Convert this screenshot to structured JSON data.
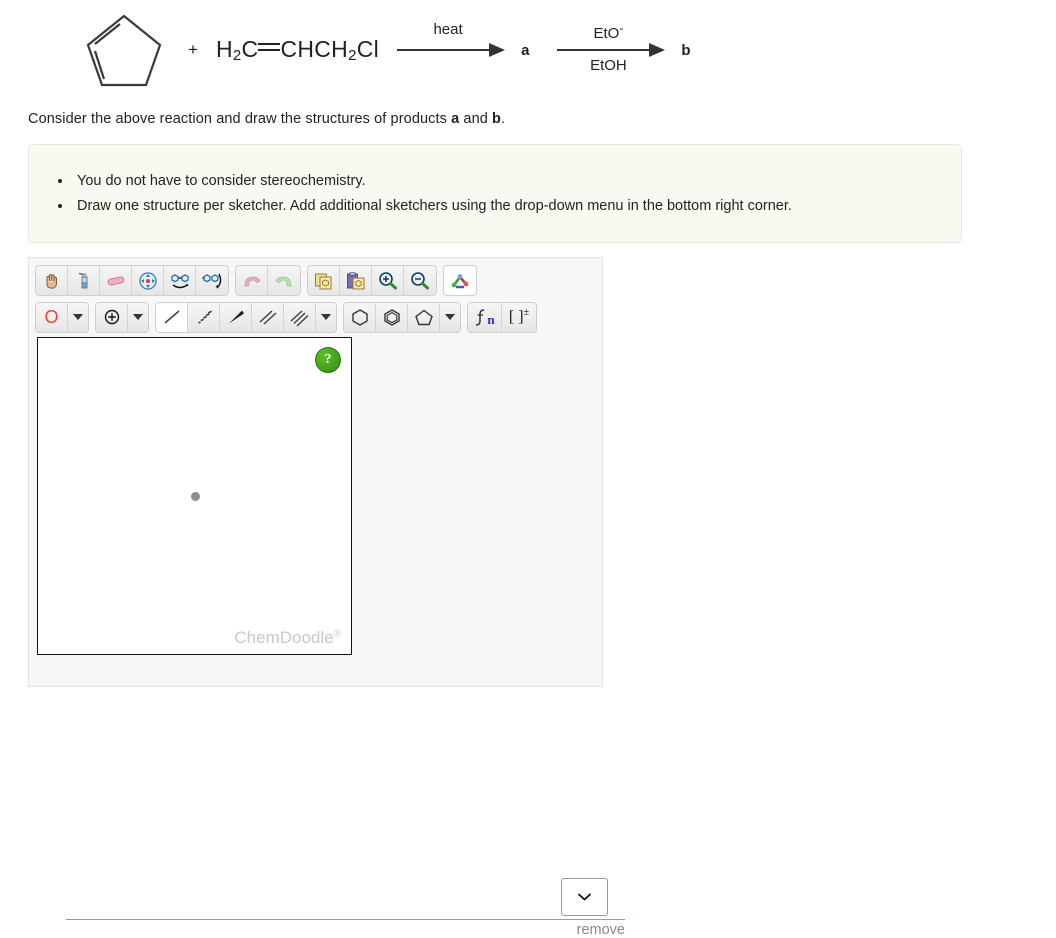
{
  "reaction": {
    "reactant_structure": "cyclopentadiene-ring",
    "plus": "+",
    "reactant_formula_parts": {
      "h": "H",
      "h_sub": "2",
      "c1": "C",
      "ch": "CHCH",
      "ch_sub": "2",
      "cl": "Cl"
    },
    "arrow1": {
      "above": "heat",
      "below": ""
    },
    "product_a": "a",
    "arrow2": {
      "above": "EtO",
      "above_sup": "-",
      "below": "EtOH"
    },
    "product_b": "b"
  },
  "prompt": {
    "text_before": "Consider the above reaction and draw the structures of products ",
    "bold_a": "a",
    "text_middle": " and ",
    "bold_b": "b",
    "text_after": "."
  },
  "notes": {
    "items": [
      "You do not have to consider stereochemistry.",
      "Draw one structure per sketcher. Add additional sketchers using the drop-down menu in the bottom right corner."
    ]
  },
  "sketcher": {
    "toolbar_row1": [
      {
        "name": "pan-hand-icon",
        "title": "Pan",
        "selected": false
      },
      {
        "name": "clear-bottle-icon",
        "title": "Clear",
        "selected": false
      },
      {
        "name": "eraser-icon",
        "title": "Erase",
        "selected": false
      },
      {
        "name": "center-target-icon",
        "title": "Center",
        "selected": false
      },
      {
        "name": "flip-horizontal-icon",
        "title": "Flip Horizontal",
        "selected": false
      },
      {
        "name": "flip-vertical-icon",
        "title": "Flip Vertical",
        "selected": false
      },
      {
        "name": "undo-icon",
        "title": "Undo",
        "selected": false
      },
      {
        "name": "redo-icon",
        "title": "Redo",
        "selected": false
      },
      {
        "name": "copy-icon",
        "title": "Copy",
        "selected": false
      },
      {
        "name": "paste-icon",
        "title": "Paste",
        "selected": false
      },
      {
        "name": "zoom-in-icon",
        "title": "Zoom In",
        "selected": false
      },
      {
        "name": "zoom-out-icon",
        "title": "Zoom Out",
        "selected": false
      },
      {
        "name": "clean-structure-icon",
        "title": "Clean Structure",
        "selected": true
      }
    ],
    "toolbar_row2": {
      "atom_label": "O",
      "charge_tool": "charge-plus-icon",
      "bond_tools": [
        {
          "name": "single-bond-icon",
          "selected": true
        },
        {
          "name": "hashed-wedge-bond-icon",
          "selected": false
        },
        {
          "name": "solid-wedge-bond-icon",
          "selected": false
        },
        {
          "name": "double-bond-icon",
          "selected": false
        },
        {
          "name": "triple-bond-icon",
          "selected": false
        }
      ],
      "ring_tools": [
        {
          "name": "cyclohexane-ring-icon",
          "selected": false
        },
        {
          "name": "benzene-ring-icon",
          "selected": false
        },
        {
          "name": "cyclopentane-ring-icon",
          "selected": false
        }
      ],
      "chain_tool": {
        "name": "repeat-chain-icon",
        "label": "n"
      },
      "bracket_tool": {
        "name": "bracket-charge-icon",
        "label": "[ ]",
        "sup": "±"
      }
    },
    "canvas": {
      "help_label": "?",
      "watermark": "ChemDoodle",
      "watermark_sup": "®"
    },
    "footer": {
      "dropdown_value": "",
      "remove_label": "remove"
    }
  },
  "colors": {
    "notes_bg": "#faf9f1",
    "notes_border": "#e8e7df",
    "panel_bg": "#f7f7f7",
    "atom_label_red": "#e8403a",
    "help_green": "#3f9b18",
    "rule_red": "#c08b8b",
    "watermark_gray": "#c8c8c8"
  }
}
